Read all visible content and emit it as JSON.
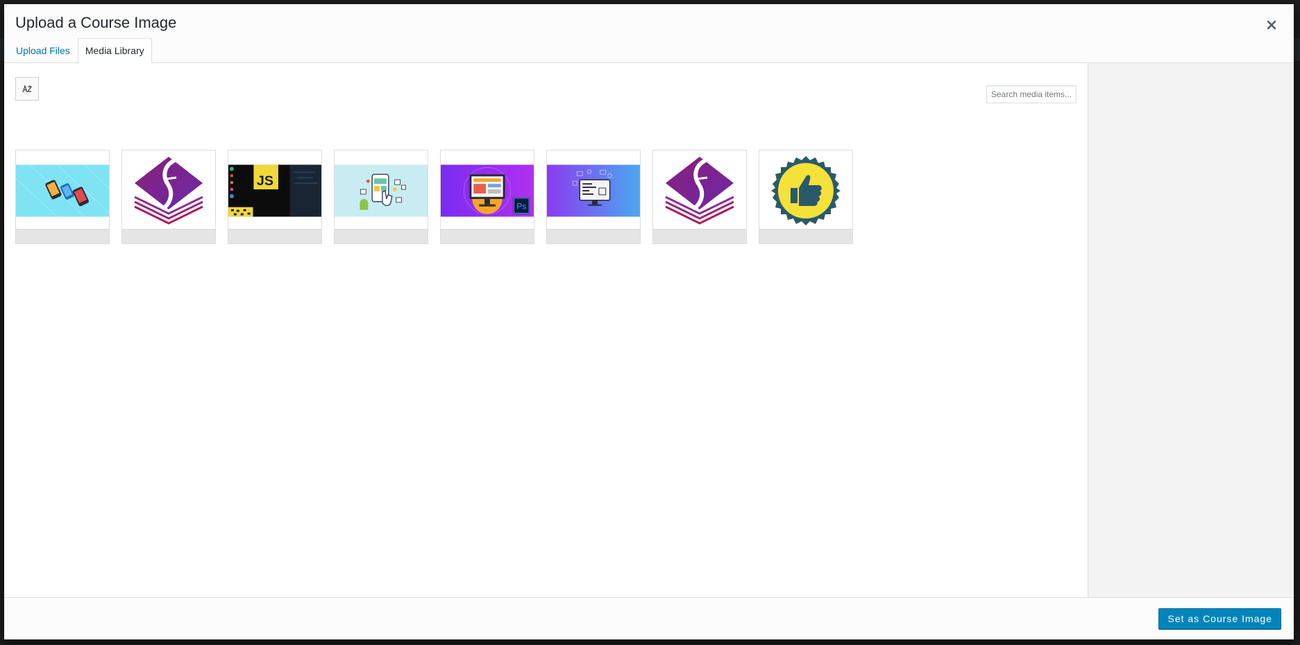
{
  "modal": {
    "title": "Upload a Course Image"
  },
  "tabs": [
    {
      "label": "Upload Files",
      "active": false
    },
    {
      "label": "Media Library",
      "active": true
    }
  ],
  "toolbar": {
    "sort_icon": "sort-alpha-icon"
  },
  "search": {
    "placeholder": "Search media items..."
  },
  "media_items": [
    {
      "name": "phones-transfer-image"
    },
    {
      "name": "purple-layers-logo-image"
    },
    {
      "name": "javascript-course-image"
    },
    {
      "name": "mobile-app-icons-image"
    },
    {
      "name": "photoshop-web-design-image"
    },
    {
      "name": "web-code-monitor-image"
    },
    {
      "name": "purple-layers-logo-image"
    },
    {
      "name": "thumbs-up-badge-image"
    }
  ],
  "thumb_text": {
    "js": "JS",
    "ps": "Ps"
  },
  "footer": {
    "primary_label": "Set as Course Image"
  },
  "colors": {
    "accent": "#0085ba",
    "link": "#0073aa",
    "sidebar_bg": "#f3f3f3"
  }
}
